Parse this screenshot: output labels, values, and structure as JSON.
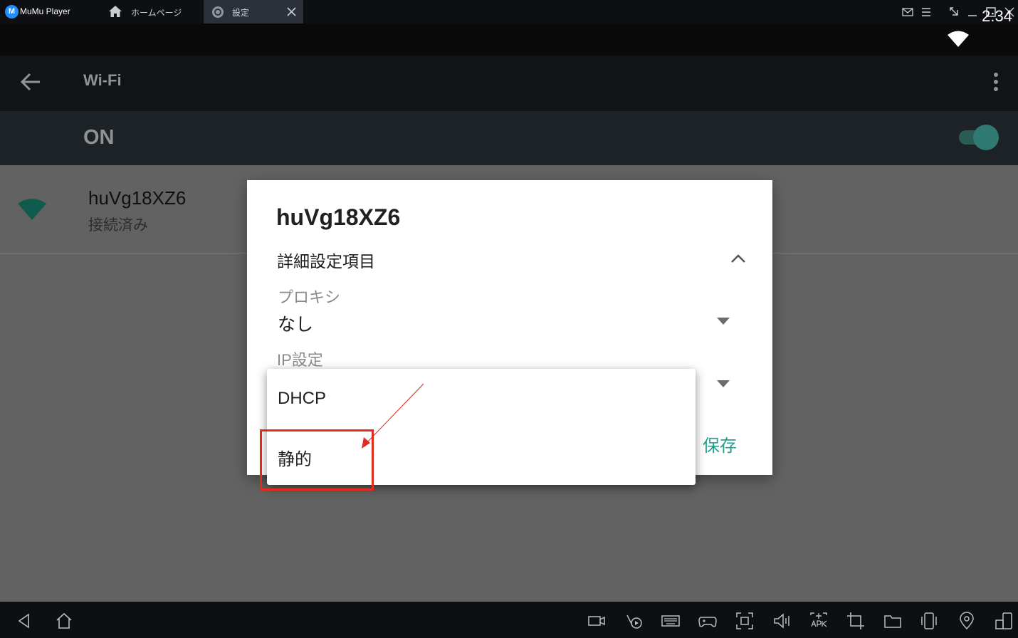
{
  "emulator": {
    "app_name": "MuMu Player",
    "logo_letter": "M",
    "tabs": [
      {
        "label": "ホームページ",
        "icon": "home-icon"
      },
      {
        "label": "設定",
        "icon": "gear-icon"
      }
    ]
  },
  "status_bar": {
    "time": "2:34"
  },
  "app_bar": {
    "title": "Wi-Fi"
  },
  "wifi_switch": {
    "label": "ON",
    "state": true
  },
  "network": {
    "name": "huVg18XZ6",
    "status": "接続済み"
  },
  "dialog": {
    "title": "huVg18XZ6",
    "advanced_label": "詳細設定項目",
    "proxy": {
      "label": "プロキシ",
      "value": "なし"
    },
    "ip": {
      "label": "IP設定"
    },
    "save_label": "保存"
  },
  "ip_dropdown": {
    "options": [
      "DHCP",
      "静的"
    ],
    "highlighted": "静的"
  },
  "colors": {
    "accent": "#2a9d8f",
    "annotation": "#e22b1d",
    "scrim": "#626262"
  }
}
